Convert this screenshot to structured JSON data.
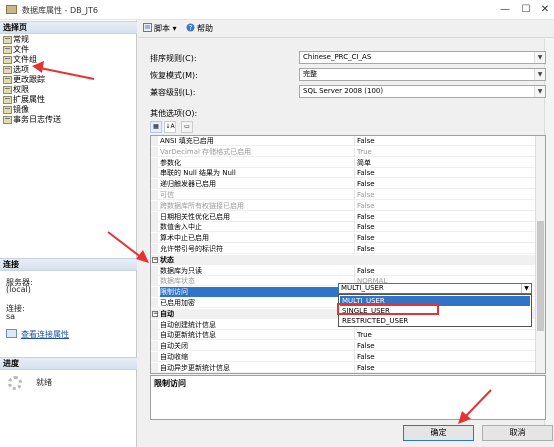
{
  "window": {
    "title": "数据库属性 - DB_JT6",
    "min": "—",
    "max": "☐",
    "close": "✕"
  },
  "sidebar": {
    "select_page_header": "选择页",
    "items": [
      {
        "label": "常规"
      },
      {
        "label": "文件"
      },
      {
        "label": "文件组"
      },
      {
        "label": "选项"
      },
      {
        "label": "更改跟踪"
      },
      {
        "label": "权限"
      },
      {
        "label": "扩展属性"
      },
      {
        "label": "镜像"
      },
      {
        "label": "事务日志传送"
      }
    ],
    "connection_header": "连接",
    "server_label": "服务器:",
    "server_value": "(local)",
    "conn_label": "连接:",
    "conn_value": "sa",
    "view_conn_link": "查看连接属性",
    "progress_header": "进度",
    "progress_status": "就绪"
  },
  "toolbar": {
    "script_label": "脚本",
    "help_label": "帮助"
  },
  "form": {
    "collation_label": "排序规则(C):",
    "collation_value": "Chinese_PRC_CI_AS",
    "recovery_label": "恢复模式(M):",
    "recovery_value": "完整",
    "compat_label": "兼容级别(L):",
    "compat_value": "SQL Server 2008 (100)",
    "other_label": "其他选项(O):"
  },
  "props": [
    {
      "name": "ANSI 填充已启用",
      "value": "False"
    },
    {
      "name": "VarDecimal 存储格式已启用",
      "value": "True",
      "disabled": true
    },
    {
      "name": "参数化",
      "value": "简单"
    },
    {
      "name": "串联的 Null 结果为 Null",
      "value": "False"
    },
    {
      "name": "递归触发器已启用",
      "value": "False"
    },
    {
      "name": "可信",
      "value": "False",
      "disabled": true
    },
    {
      "name": "跨数据库所有权链接已启用",
      "value": "False",
      "disabled": true
    },
    {
      "name": "日期相关性优化已启用",
      "value": "False"
    },
    {
      "name": "数值舍入中止",
      "value": "False"
    },
    {
      "name": "算术中止已启用",
      "value": "False"
    },
    {
      "name": "允许带引号的标识符",
      "value": "False"
    },
    {
      "name": "状态",
      "value": "",
      "category": true
    },
    {
      "name": "数据库为只读",
      "value": "False"
    },
    {
      "name": "数据库状态",
      "value": "NORMAL",
      "disabled": true
    },
    {
      "name": "限制访问",
      "value": "",
      "selected": true
    },
    {
      "name": "已启用加密",
      "value": ""
    },
    {
      "name": "自动",
      "value": "",
      "category": true
    },
    {
      "name": "自动创建统计信息",
      "value": ""
    },
    {
      "name": "自动更新统计信息",
      "value": "True"
    },
    {
      "name": "自动关闭",
      "value": "False"
    },
    {
      "name": "自动收缩",
      "value": "False"
    },
    {
      "name": "自动异步更新统计信息",
      "value": "False"
    }
  ],
  "dropdown": {
    "current": "MULTI_USER",
    "options": [
      "MULTI_USER",
      "SINGLE_USER",
      "RESTRICTED_USER"
    ]
  },
  "description_title": "限制访问",
  "buttons": {
    "ok": "确定",
    "cancel": "取消"
  },
  "colors": {
    "accent": "#3074c8",
    "annotation": "#e53333"
  }
}
